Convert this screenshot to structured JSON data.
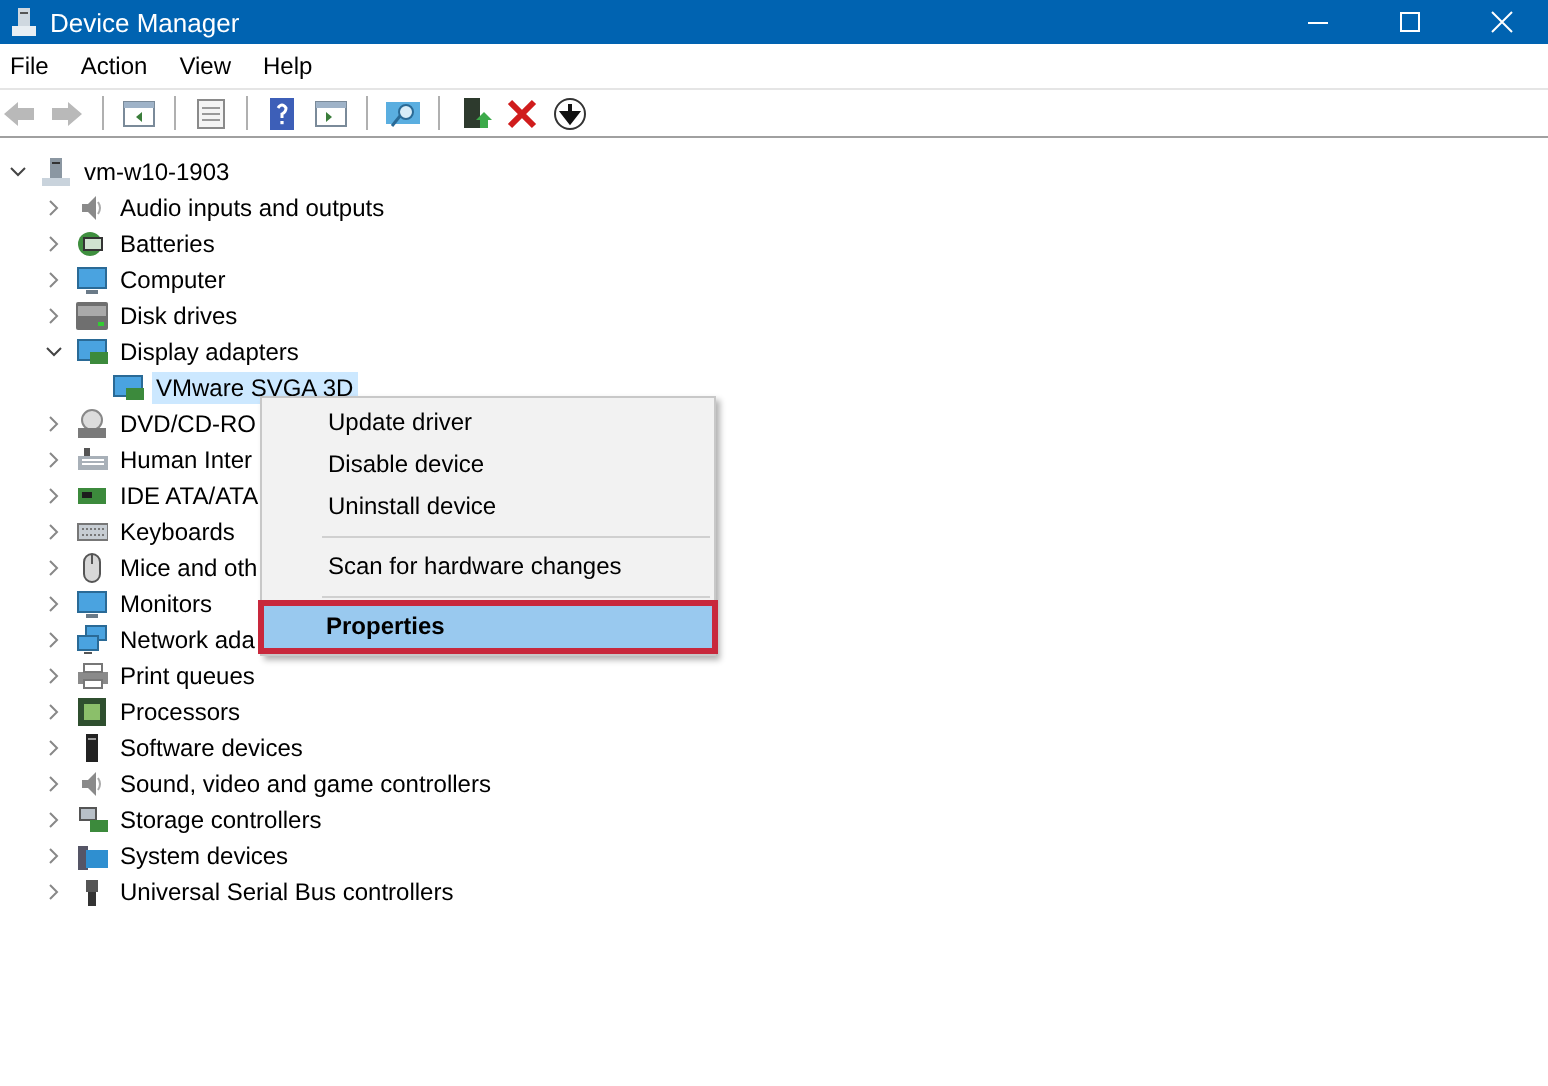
{
  "window": {
    "title": "Device Manager"
  },
  "menu_bar": [
    "File",
    "Action",
    "View",
    "Help"
  ],
  "tree": {
    "label": "vm-w10-1903",
    "expanded": true,
    "selected": false,
    "children": [
      {
        "label": "Audio inputs and outputs",
        "expanded": false,
        "selected": false
      },
      {
        "label": "Batteries",
        "expanded": false,
        "selected": false
      },
      {
        "label": "Computer",
        "expanded": false,
        "selected": false
      },
      {
        "label": "Disk drives",
        "expanded": false,
        "selected": false
      },
      {
        "label": "Display adapters",
        "expanded": true,
        "selected": false,
        "children": [
          {
            "label": "VMware SVGA 3D",
            "selected": true
          }
        ]
      },
      {
        "label": "DVD/CD-RO",
        "expanded": false,
        "selected": false
      },
      {
        "label": "Human Inter",
        "expanded": false,
        "selected": false
      },
      {
        "label": "IDE ATA/ATA",
        "expanded": false,
        "selected": false
      },
      {
        "label": "Keyboards",
        "expanded": false,
        "selected": false
      },
      {
        "label": "Mice and oth",
        "expanded": false,
        "selected": false
      },
      {
        "label": "Monitors",
        "expanded": false,
        "selected": false
      },
      {
        "label": "Network ada",
        "expanded": false,
        "selected": false
      },
      {
        "label": "Print queues",
        "expanded": false,
        "selected": false
      },
      {
        "label": "Processors",
        "expanded": false,
        "selected": false
      },
      {
        "label": "Software devices",
        "expanded": false,
        "selected": false
      },
      {
        "label": "Sound, video and game controllers",
        "expanded": false,
        "selected": false
      },
      {
        "label": "Storage controllers",
        "expanded": false,
        "selected": false
      },
      {
        "label": "System devices",
        "expanded": false,
        "selected": false
      },
      {
        "label": "Universal Serial Bus controllers",
        "expanded": false,
        "selected": false
      }
    ]
  },
  "context_menu": {
    "items": [
      {
        "kind": "item",
        "label": "Update driver",
        "selected": false,
        "default": false
      },
      {
        "kind": "item",
        "label": "Disable device",
        "selected": false,
        "default": false
      },
      {
        "kind": "item",
        "label": "Uninstall device",
        "selected": false,
        "default": false
      },
      {
        "kind": "separator"
      },
      {
        "kind": "item",
        "label": "Scan for hardware changes",
        "selected": false,
        "default": false
      },
      {
        "kind": "separator"
      },
      {
        "kind": "item",
        "label": "Properties",
        "selected": true,
        "default": true
      }
    ]
  }
}
